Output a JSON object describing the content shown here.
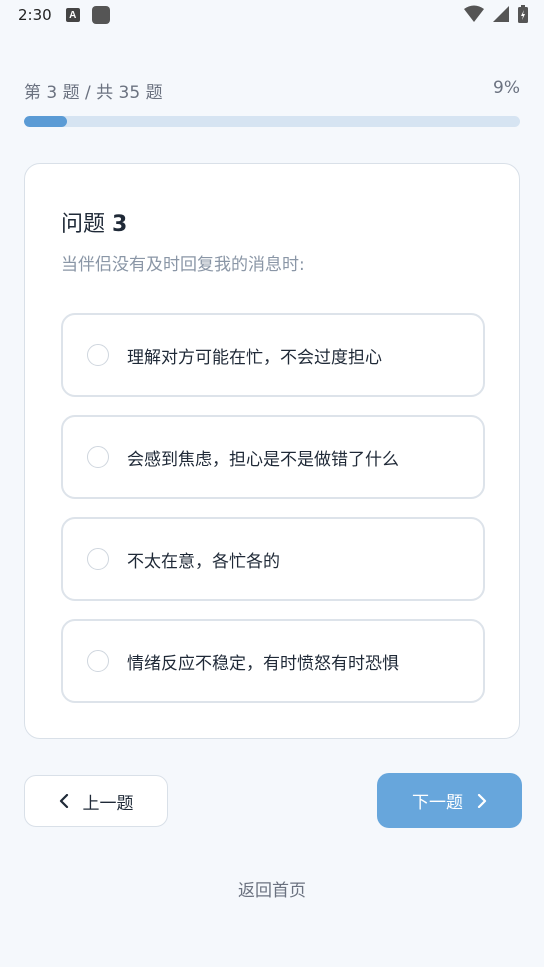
{
  "status_bar": {
    "time": "2:30",
    "notification_letter": "A"
  },
  "progress": {
    "label": "第 3 题 / 共 35 题",
    "percent_text": "9%",
    "fraction": 0.086
  },
  "question": {
    "title_prefix": "问题",
    "number": "3",
    "text": "当伴侣没有及时回复我的消息时:",
    "options": [
      "理解对方可能在忙，不会过度担心",
      "会感到焦虑，担心是不是做错了什么",
      "不太在意，各忙各的",
      "情绪反应不稳定，有时愤怒有时恐惧"
    ]
  },
  "nav": {
    "prev_label": "上一题",
    "next_label": "下一题",
    "home_label": "返回首页"
  },
  "colors": {
    "accent": "#5b9bd5",
    "next_button": "#67a6dc",
    "background": "#f5f8fc"
  }
}
